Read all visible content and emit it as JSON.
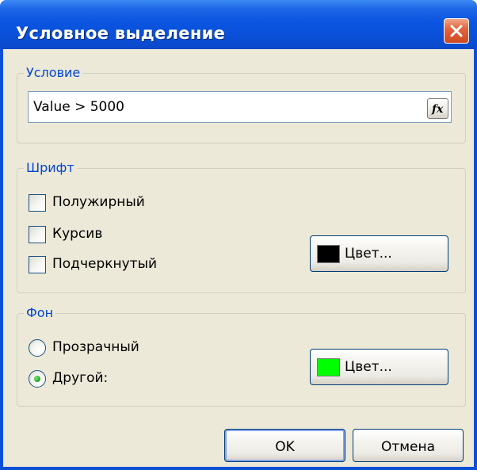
{
  "dialog": {
    "title": "Условное выделение"
  },
  "condition_group": {
    "legend": "Условие",
    "expression_value": "Value > 5000",
    "function_button_icon": "fx-icon"
  },
  "font_group": {
    "legend": "Шрифт",
    "options": [
      {
        "label": "Полужирный",
        "checked": false
      },
      {
        "label": "Курсив",
        "checked": false
      },
      {
        "label": "Подчеркнутый",
        "checked": false
      }
    ],
    "color_button_label": "Цвет...",
    "color": "#000000"
  },
  "background_group": {
    "legend": "Фон",
    "options": [
      {
        "label": "Прозрачный",
        "selected": false
      },
      {
        "label": "Другой:",
        "selected": true
      }
    ],
    "color_button_label": "Цвет...",
    "color": "#00ff00"
  },
  "footer": {
    "ok_label": "OK",
    "cancel_label": "Отмена"
  },
  "colors": {
    "title_bar": "#0a4fd8",
    "dialog_face": "#ece9d8",
    "group_legend_text": "#0046d5",
    "close_button": "#e2643f"
  }
}
